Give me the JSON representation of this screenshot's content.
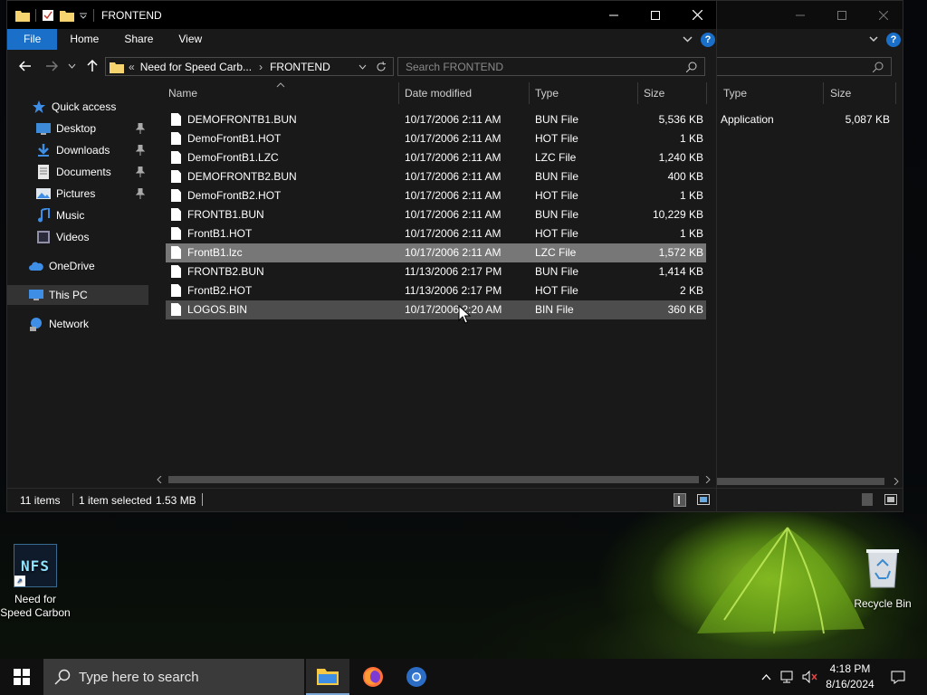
{
  "desktop": {
    "icons": [
      {
        "label": "Need for Speed Carbon",
        "tile_text": "NFS"
      },
      {
        "label": "Recycle Bin"
      }
    ]
  },
  "back_window": {
    "columns": [
      "Type",
      "Size"
    ],
    "rows": [
      {
        "type": "Application",
        "size": "5,087 KB"
      }
    ]
  },
  "window": {
    "title": "FRONTEND",
    "ribbon_tabs": [
      "File",
      "Home",
      "Share",
      "View"
    ],
    "help_label": "?",
    "breadcrumb": {
      "overflow": "«",
      "parent": "Need for Speed Carb...",
      "separator": "›",
      "current": "FRONTEND"
    },
    "search_placeholder": "Search FRONTEND",
    "nav": [
      {
        "label": "Quick access",
        "icon": "star-icon"
      },
      {
        "label": "Desktop",
        "icon": "desktop-icon",
        "pinned": true
      },
      {
        "label": "Downloads",
        "icon": "download-icon",
        "pinned": true
      },
      {
        "label": "Documents",
        "icon": "documents-icon",
        "pinned": true
      },
      {
        "label": "Pictures",
        "icon": "pictures-icon",
        "pinned": true
      },
      {
        "label": "Music",
        "icon": "music-icon"
      },
      {
        "label": "Videos",
        "icon": "videos-icon"
      },
      {
        "label": "OneDrive",
        "icon": "cloud-icon"
      },
      {
        "label": "This PC",
        "icon": "computer-icon",
        "selected": true
      },
      {
        "label": "Network",
        "icon": "network-icon"
      }
    ],
    "columns": [
      "Name",
      "Date modified",
      "Type",
      "Size"
    ],
    "files": [
      {
        "name": "DEMOFRONTB1.BUN",
        "date": "10/17/2006 2:11 AM",
        "type": "BUN File",
        "size": "5,536 KB"
      },
      {
        "name": "DemoFrontB1.HOT",
        "date": "10/17/2006 2:11 AM",
        "type": "HOT File",
        "size": "1 KB"
      },
      {
        "name": "DemoFrontB1.LZC",
        "date": "10/17/2006 2:11 AM",
        "type": "LZC File",
        "size": "1,240 KB"
      },
      {
        "name": "DEMOFRONTB2.BUN",
        "date": "10/17/2006 2:11 AM",
        "type": "BUN File",
        "size": "400 KB"
      },
      {
        "name": "DemoFrontB2.HOT",
        "date": "10/17/2006 2:11 AM",
        "type": "HOT File",
        "size": "1 KB"
      },
      {
        "name": "FRONTB1.BUN",
        "date": "10/17/2006 2:11 AM",
        "type": "BUN File",
        "size": "10,229 KB"
      },
      {
        "name": "FrontB1.HOT",
        "date": "10/17/2006 2:11 AM",
        "type": "HOT File",
        "size": "1 KB"
      },
      {
        "name": "FrontB1.lzc",
        "date": "10/17/2006 2:11 AM",
        "type": "LZC File",
        "size": "1,572 KB",
        "selected": true
      },
      {
        "name": "FRONTB2.BUN",
        "date": "11/13/2006 2:17 PM",
        "type": "BUN File",
        "size": "1,414 KB"
      },
      {
        "name": "FrontB2.HOT",
        "date": "11/13/2006 2:17 PM",
        "type": "HOT File",
        "size": "2 KB"
      },
      {
        "name": "LOGOS.BIN",
        "date": "10/17/2006 2:20 AM",
        "type": "BIN File",
        "size": "360 KB",
        "hover": true
      }
    ],
    "status": {
      "items": "11 items",
      "selected": "1 item selected",
      "size": "1.53 MB"
    }
  },
  "taskbar": {
    "search_placeholder": "Type here to search",
    "apps": [
      "file-explorer-icon",
      "firefox-icon",
      "chrome-icon"
    ],
    "time": "4:18 PM",
    "date": "8/16/2024"
  },
  "colors": {
    "accent": "#1a6fc8",
    "window_bg": "#191919",
    "selection": "#777777",
    "hover": "#4d4d4d"
  }
}
